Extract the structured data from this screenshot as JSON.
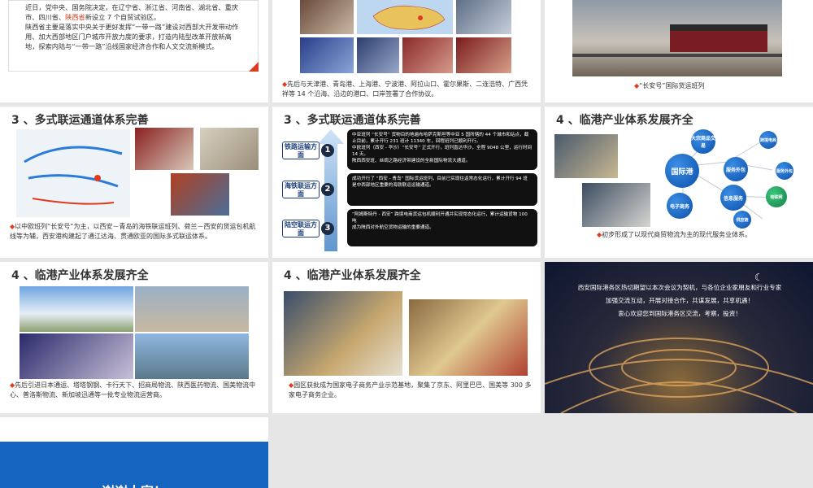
{
  "slides": {
    "s1": {
      "text_a": "近日，党中央、国务院决定，在辽宁省、浙江省、河南省、湖北省、重庆市、四川省、",
      "text_highlight": "陕西省",
      "text_b": "新设立 7 个自贸试验区。",
      "text_c": "陕西省主要是落实中央关于更好发挥“一带一路”建设对西部大开发带动作用、加大西部地区门户城市开放力度的要求，打造内陆型改革开放新高地，探索内陆与“一带一路”沿线国家经济合作和人文交流新模式。"
    },
    "s2": {
      "caption": "先后与天津港、青岛港、上海港、宁波港、阿拉山口、霍尔果斯、二连浩特、广西凭祥等 14 个沿海、沿边的港口、口岸签署了合作协议。"
    },
    "s3": {
      "caption": "“长安号”国际货运班列"
    },
    "s4": {
      "title": "3 、多式联运通道体系完善",
      "caption": "以中欧班列“长安号”为主，以西安－青岛的海铁联运班列、荷兰－西安的货运包机航线等为辅，西安港构建起了通江达海、贯通欧亚的国际多式联运体系。"
    },
    "s5": {
      "title": "3 、多式联运通道体系完善",
      "steps": [
        {
          "label": "铁路运输方面",
          "num": "1",
          "text": "中亚班列 “长安号” 货物目的地遍布哈萨克斯坦等中亚 5 国所辖的 44 个城市和站点，截止目前，累计开行 231 班计 11340 车，回程班列已顺利开行。\n中欧班列（西安 - 华沙）“长安号” 正式开行，班列直达华沙，全程 9048 公里，运行时间 14 天。\n陕西西安班、丝绸之路经济带建设的全新国际物流大通道。"
        },
        {
          "label": "海铁联运方面",
          "num": "2",
          "text": "成功开行了 “西安 - 青岛” 国际货运班列，目前已实现往返常态化运行，累计开行 94 班\n是中西部地区重要的海铁联运运输通道。"
        },
        {
          "label": "陆空联运方面",
          "num": "3",
          "text": "“阿姆斯特丹 - 西安” 跨境电商货运包机顺利开通并实现常态化运行，累计运输货物 100 吨\n成为陕西对外航空货物运输的重要通道。"
        }
      ]
    },
    "s6": {
      "title": "4 、临港产业体系发展齐全",
      "nodes": {
        "center": "国际港",
        "trade": "大宗商品交易",
        "finance": "服务外包",
        "ecommerce": "电子商务",
        "info": "信息服务",
        "n1": "跨境电商",
        "n2": "服务外包",
        "n3": "物联网",
        "n4": "供应链",
        "n5": "金融服务"
      },
      "caption": "初步形成了以现代商贸物流为主的现代服务业体系。"
    },
    "s7": {
      "title": "4 、临港产业体系发展齐全",
      "caption": "先后引进日本通运、塔塔钢钢、卡行天下、招商局物流、陕西医药物流、国美物流中心、普洛斯物流、新加坡迅通等一批专业物流运营商。"
    },
    "s8": {
      "title": "4 、临港产业体系发展齐全",
      "caption": "园区获批成为国家电子商务产业示范基地，聚集了京东、阿里巴巴、国美等 300 多家电子商务企业。"
    },
    "s9": {
      "line1": "西安国际港务区热切期望以本次会议为契机，与各位企业家朋友和行业专家",
      "line2": "加强交流互动，开展对接合作，共谋发展，共享机遇！",
      "line3": "衷心欢迎您到国际港务区交流，考察，投资！"
    },
    "s10": {
      "thanks": "谢谢大家！"
    }
  },
  "colors": {
    "accent": "#e03a1e",
    "brand_blue": "#1565c0",
    "dark_navy": "#1c2b44"
  }
}
